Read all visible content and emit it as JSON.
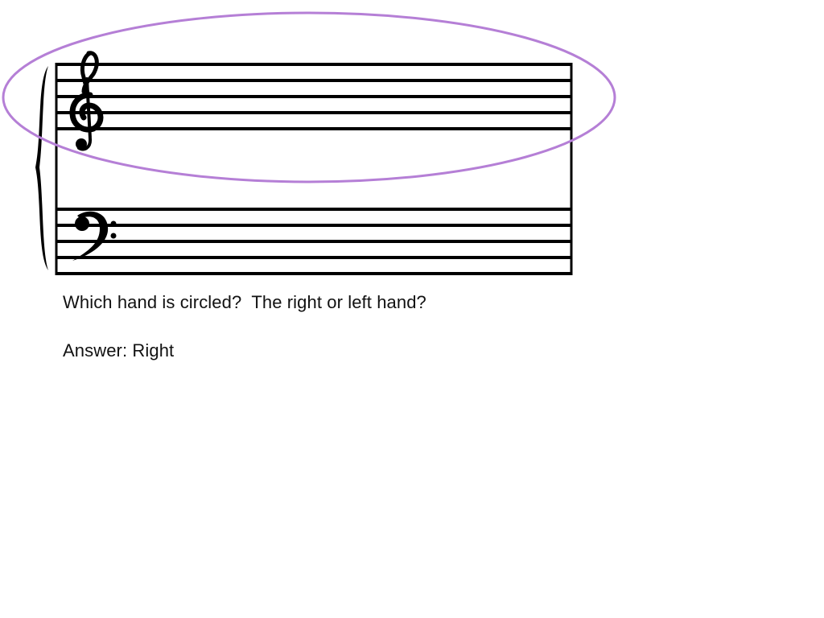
{
  "question": "Which hand is circled?  The right or left hand?",
  "answer": "Answer: Right",
  "highlight_color": "#b57fd6",
  "staff_color": "#000000",
  "icons": {
    "treble_clef": "treble-clef-icon",
    "bass_clef": "bass-clef-icon",
    "brace": "grand-staff-brace"
  }
}
